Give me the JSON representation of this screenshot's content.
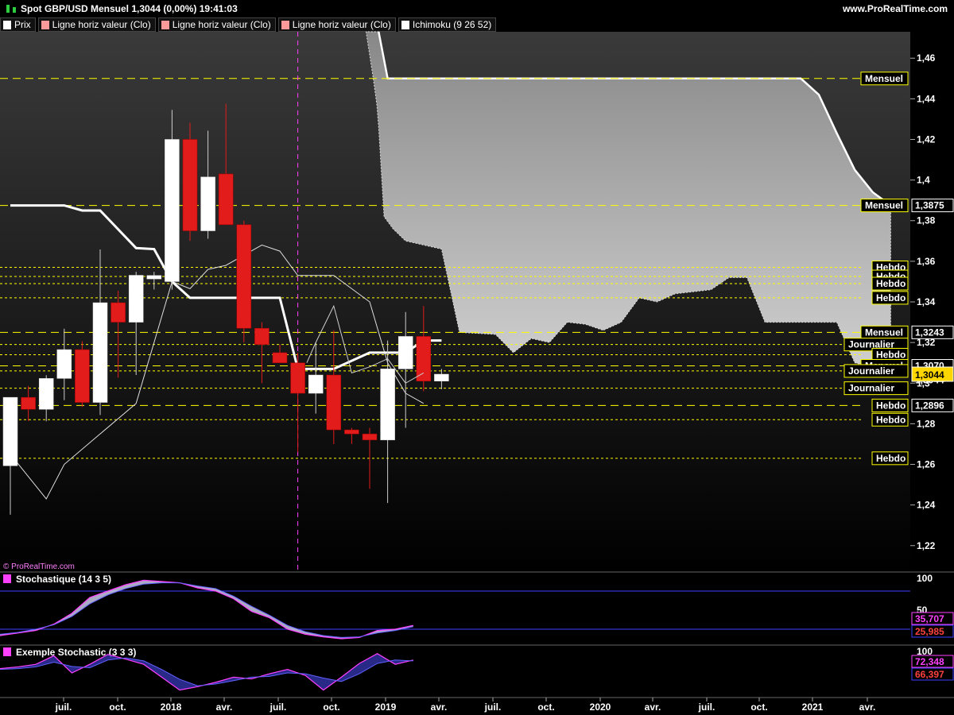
{
  "header": {
    "title": "Spot GBP/USD Mensuel 1,3044 (0,00%) 19:41:03",
    "site": "www.ProRealTime.com"
  },
  "legend": [
    {
      "label": "Prix",
      "color": "#ffffff"
    },
    {
      "label": "Ligne horiz valeur (Clo)",
      "color": "#ff9a9a"
    },
    {
      "label": "Ligne horiz valeur (Clo)",
      "color": "#ff9a9a"
    },
    {
      "label": "Ligne horiz valeur (Clo)",
      "color": "#ff9a9a"
    },
    {
      "label": "Ichimoku (9 26 52)",
      "color": "#ffffff"
    }
  ],
  "watermark": "© ProRealTime.com",
  "colors": {
    "bull": "#ffffff",
    "bear": "#e21b1b",
    "level": "#ffff00",
    "cloud": "#b4b4b4",
    "kijun": "#ffffff",
    "stoch_k": "#ff40ff",
    "stoch_d": "#4040ff"
  },
  "chart_data": [
    {
      "type": "candlestick",
      "y_ticks": [
        "1,46",
        "1,44",
        "1,42",
        "1,4",
        "1,38",
        "1,36",
        "1,34",
        "1,32",
        "1,3",
        "1,28",
        "1,26",
        "1,24",
        "1,22"
      ],
      "ylim": [
        1.207,
        1.473
      ],
      "x_ticks": [
        "juil.",
        "oct.",
        "2018",
        "avr.",
        "juil.",
        "oct.",
        "2019",
        "avr.",
        "juil.",
        "oct.",
        "2020",
        "avr.",
        "juil.",
        "oct.",
        "2021",
        "avr."
      ],
      "series": [
        {
          "name": "Prix",
          "candles": [
            [
              1.2593,
              1.2901,
              1.2352,
              1.293
            ],
            [
              1.293,
              1.2986,
              1.2814,
              1.2871
            ],
            [
              1.2871,
              1.3039,
              1.2812,
              1.3023
            ],
            [
              1.3023,
              1.3268,
              1.2916,
              1.3165
            ],
            [
              1.3165,
              1.3206,
              1.2883,
              1.2905
            ],
            [
              1.2905,
              1.3658,
              1.2843,
              1.3396
            ],
            [
              1.3396,
              1.3455,
              1.3027,
              1.33
            ],
            [
              1.33,
              1.3548,
              1.304,
              1.3531
            ],
            [
              1.3513,
              1.3548,
              1.3461,
              1.353
            ],
            [
              1.35,
              1.4345,
              1.346,
              1.42
            ],
            [
              1.42,
              1.4282,
              1.37,
              1.375
            ],
            [
              1.375,
              1.4243,
              1.3711,
              1.4015
            ],
            [
              1.403,
              1.4376,
              1.39,
              1.378
            ],
            [
              1.378,
              1.38,
              1.32,
              1.327
            ],
            [
              1.327,
              1.33,
              1.3,
              1.319
            ],
            [
              1.315,
              1.313,
              1.319,
              1.31
            ],
            [
              1.31,
              1.315,
              1.266,
              1.295
            ],
            [
              1.295,
              1.32,
              1.285,
              1.304
            ],
            [
              1.304,
              1.326,
              1.27,
              1.277
            ],
            [
              1.277,
              1.278,
              1.27,
              1.275
            ],
            [
              1.275,
              1.278,
              1.248,
              1.272
            ],
            [
              1.272,
              1.321,
              1.241,
              1.307
            ],
            [
              1.307,
              1.335,
              1.278,
              1.323
            ],
            [
              1.323,
              1.338,
              1.296,
              1.301
            ],
            [
              1.301,
              1.307,
              1.297,
              1.3044
            ]
          ]
        },
        {
          "name": "Tenkan",
          "points": [
            [
              0,
              1.265
            ],
            [
              2,
              1.243
            ],
            [
              3,
              1.26
            ],
            [
              5,
              1.275
            ],
            [
              7,
              1.29
            ],
            [
              9,
              1.35
            ],
            [
              10,
              1.3465
            ],
            [
              11,
              1.356
            ],
            [
              12,
              1.358
            ],
            [
              14,
              1.368
            ],
            [
              15,
              1.365
            ],
            [
              16,
              1.353
            ],
            [
              17,
              1.353
            ],
            [
              18,
              1.353
            ],
            [
              20,
              1.34
            ],
            [
              21,
              1.31
            ],
            [
              22,
              1.295
            ],
            [
              23,
              1.29
            ]
          ]
        },
        {
          "name": "Kijun",
          "points": [
            [
              0,
              1.3875
            ],
            [
              3,
              1.3875
            ],
            [
              4,
              1.385
            ],
            [
              5,
              1.385
            ],
            [
              7,
              1.3665
            ],
            [
              8,
              1.366
            ],
            [
              9,
              1.35
            ],
            [
              10,
              1.342
            ],
            [
              15,
              1.342
            ],
            [
              16,
              1.307
            ],
            [
              18,
              1.307
            ],
            [
              20,
              1.315
            ],
            [
              22,
              1.315
            ],
            [
              23,
              1.321
            ],
            [
              24,
              1.321
            ]
          ]
        },
        {
          "name": "Chikou",
          "points": [
            [
              16.5,
              1.31
            ],
            [
              17,
              1.32
            ],
            [
              18,
              1.338
            ],
            [
              19,
              1.305
            ],
            [
              20,
              1.308
            ],
            [
              21,
              1.312
            ],
            [
              22,
              1.3
            ],
            [
              23,
              1.305
            ]
          ]
        },
        {
          "name": "Nuage",
          "top": [
            [
              20.5,
              1.473
            ],
            [
              21,
              1.45
            ],
            [
              44,
              1.45
            ],
            [
              45,
              1.442
            ],
            [
              46,
              1.423
            ],
            [
              47,
              1.405
            ],
            [
              48,
              1.394
            ],
            [
              49,
              1.3875
            ]
          ],
          "bottom": [
            [
              19.8,
              1.473
            ],
            [
              20.2,
              1.45
            ],
            [
              20.4,
              1.437
            ],
            [
              20.5,
              1.426
            ],
            [
              20.8,
              1.382
            ],
            [
              21.3,
              1.376
            ],
            [
              22,
              1.37
            ],
            [
              23,
              1.368
            ],
            [
              24,
              1.366
            ],
            [
              25,
              1.325
            ],
            [
              27,
              1.324
            ],
            [
              28,
              1.315
            ],
            [
              29,
              1.322
            ],
            [
              30,
              1.32
            ],
            [
              31,
              1.33
            ],
            [
              32,
              1.329
            ],
            [
              33,
              1.326
            ],
            [
              34,
              1.33
            ],
            [
              35,
              1.342
            ],
            [
              36,
              1.34
            ],
            [
              37,
              1.344
            ],
            [
              38,
              1.345
            ],
            [
              39,
              1.346
            ],
            [
              40,
              1.352
            ],
            [
              41,
              1.352
            ],
            [
              42,
              1.33
            ],
            [
              43,
              1.33
            ],
            [
              44,
              1.33
            ],
            [
              46,
              1.33
            ],
            [
              47,
              1.31
            ],
            [
              48,
              1.308
            ],
            [
              49,
              1.309
            ]
          ]
        }
      ],
      "levels": [
        {
          "value": 1.45,
          "label": "Mensuel",
          "style": "dashed"
        },
        {
          "value": 1.3875,
          "label": "Mensuel",
          "style": "dashed",
          "price": "1,3875"
        },
        {
          "value": 1.357,
          "label": "Hebdo",
          "style": "dotted"
        },
        {
          "value": 1.3525,
          "label": "Hebdo",
          "style": "dotted"
        },
        {
          "value": 1.349,
          "label": "Hebdo",
          "style": "dotted"
        },
        {
          "value": 1.342,
          "label": "Hebdo",
          "style": "dotted"
        },
        {
          "value": 1.325,
          "label": "Mensuel",
          "style": "dashed",
          "price": "1,3243"
        },
        {
          "value": 1.319,
          "label": "Journalier",
          "style": "dotted"
        },
        {
          "value": 1.314,
          "label": "Hebdo",
          "style": "dotted"
        },
        {
          "value": 1.3085,
          "label": "Mensuel",
          "style": "dashed",
          "price": "1,3070"
        },
        {
          "value": 1.306,
          "label": "Journalier",
          "style": "dotted"
        },
        {
          "value": 1.2975,
          "label": "Journalier",
          "style": "dotted"
        },
        {
          "value": 1.289,
          "label": "Hebdo",
          "style": "dashed",
          "price": "1,2896"
        },
        {
          "value": 1.282,
          "label": "Hebdo",
          "style": "dotted"
        },
        {
          "value": 1.263,
          "label": "Hebdo",
          "style": "dotted"
        }
      ],
      "vline_index": 16,
      "current_price": "1,3044",
      "hidden_price": "1,3044"
    },
    {
      "type": "line",
      "title": "Stochastique (14 3 5)",
      "ylim": [
        0,
        100
      ],
      "ticks": [
        "100",
        "50"
      ],
      "series": [
        {
          "name": "%K",
          "values": [
            10,
            14,
            18,
            28,
            45,
            70,
            80,
            90,
            97,
            95,
            93,
            85,
            80,
            68,
            48,
            38,
            20,
            12,
            8,
            5,
            7,
            18,
            20,
            26
          ]
        },
        {
          "name": "%D",
          "values": [
            12,
            15,
            20,
            27,
            40,
            60,
            74,
            84,
            91,
            93,
            93,
            88,
            84,
            72,
            56,
            42,
            26,
            16,
            10,
            7,
            8,
            14,
            18,
            24
          ]
        }
      ],
      "values_shown": [
        "35,707",
        "25,985"
      ]
    },
    {
      "type": "line",
      "title": "Exemple Stochastic (3 3 3)",
      "ylim": [
        0,
        100
      ],
      "ticks": [
        "100"
      ],
      "series": [
        {
          "name": "%K",
          "values": [
            60,
            64,
            70,
            90,
            50,
            70,
            93,
            82,
            70,
            40,
            10,
            18,
            28,
            40,
            36,
            48,
            58,
            44,
            10,
            40,
            72,
            95,
            70,
            80
          ]
        },
        {
          "name": "%D",
          "values": [
            58,
            60,
            64,
            75,
            65,
            62,
            80,
            85,
            78,
            58,
            35,
            20,
            24,
            32,
            40,
            42,
            50,
            48,
            38,
            30,
            48,
            72,
            80,
            78
          ]
        }
      ],
      "values_shown": [
        "72,348",
        "66,397"
      ]
    }
  ]
}
